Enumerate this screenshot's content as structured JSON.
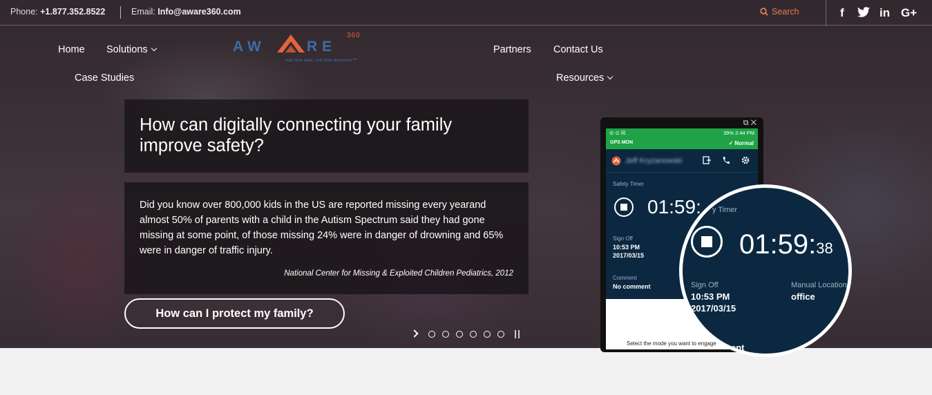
{
  "topbar": {
    "phone_label": "Phone:",
    "phone_value": "+1.877.352.8522",
    "email_label": "Email:",
    "email_value": "Info@aware360.com",
    "search_label": "Search",
    "social": [
      "f",
      "twitter-icon",
      "in",
      "G+"
    ]
  },
  "nav": {
    "home": "Home",
    "solutions": "Solutions",
    "case_studies": "Case Studies",
    "partners": "Partners",
    "contact": "Contact Us",
    "resources": "Resources"
  },
  "logo": {
    "word": "AWARE",
    "sup": "360",
    "tagline": "real time data. real time decisions™"
  },
  "hero": {
    "headline": "How can digitally connecting your family improve safety?",
    "body": "Did you know over 800,000 kids in the US are reported missing every yearand almost 50% of parents with a child in the Autism Spectrum said they had gone missing at some point, of those missing 24% were in danger of drowning and 65% were in danger of traffic injury.",
    "citation": "National Center for Missing & Exploited Children Pediatrics, 2012",
    "cta": "How can I protect my family?"
  },
  "slider": {
    "dot_count": 6
  },
  "phone": {
    "status_right": "39% 2:44 PM",
    "mode_left": "GPS  MON",
    "mode_right": "✓ Normal",
    "user_name": "Jeff Kryzanowski",
    "safety_timer_label": "Safety Timer",
    "timer": "01:59:",
    "sign_off_label": "Sign Off",
    "sign_off_time": "10:53 PM",
    "sign_off_date": "2017/03/15",
    "comment_label": "Comment",
    "comment_value": "No comment",
    "select_mode_text": "Select the mode you want to engage"
  },
  "zoom": {
    "timer_label": "y Timer",
    "timer_main": "01:59:",
    "timer_sec": "38",
    "sign_off_label": "Sign Off",
    "sign_off_time": "10:53 PM",
    "sign_off_date": "2017/03/15",
    "location_label": "Manual Location",
    "location_value": "office",
    "bottom_label": "ent"
  },
  "colors": {
    "accent": "#e67a55",
    "logo_blue": "#3f6da6",
    "logo_orange": "#e5623c",
    "app_bg": "#0b2840",
    "status_green": "#20a346"
  }
}
